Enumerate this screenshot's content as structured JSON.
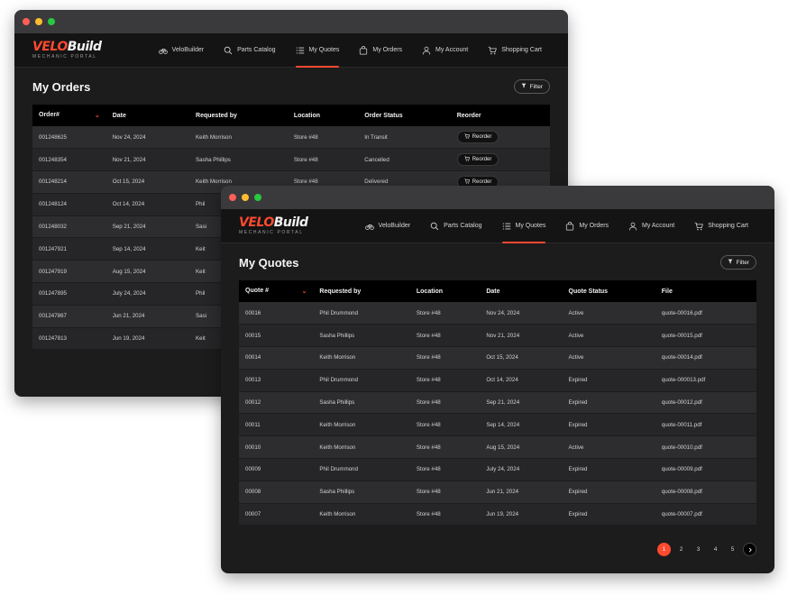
{
  "colors": {
    "accent": "#ff4a2f",
    "window_bg": "#1c1c1d",
    "navbar_bg": "#141415",
    "table_header_bg": "#000000"
  },
  "brand": {
    "logo_velo": "VELO",
    "logo_build": "Build",
    "subtitle": "Mechanic Portal"
  },
  "nav": {
    "items": [
      {
        "label": "VeloBuilder",
        "icon": "bicycle-icon"
      },
      {
        "label": "Parts Catalog",
        "icon": "search-icon"
      },
      {
        "label": "My Quotes",
        "icon": "list-icon"
      },
      {
        "label": "My Orders",
        "icon": "bag-icon"
      },
      {
        "label": "My Account",
        "icon": "user-icon"
      },
      {
        "label": "Shopping Cart",
        "icon": "cart-icon"
      }
    ]
  },
  "orders_window": {
    "active_nav": "My Quotes",
    "title": "My Orders",
    "filter_label": "Filter",
    "columns": [
      "Order#",
      "Date",
      "Requested by",
      "Location",
      "Order Status",
      "Reorder"
    ],
    "reorder_label": "Reorder",
    "rows": [
      {
        "order": "001248625",
        "date": "Nov 24, 2024",
        "requested_by": "Keith Morrison",
        "location": "Store #48",
        "status": "In Transit"
      },
      {
        "order": "001248354",
        "date": "Nov 21, 2024",
        "requested_by": "Sasha Phillips",
        "location": "Store #48",
        "status": "Cancelled"
      },
      {
        "order": "001248214",
        "date": "Oct 15, 2024",
        "requested_by": "Keith Morrison",
        "location": "Store #48",
        "status": "Delivered"
      },
      {
        "order": "001248124",
        "date": "Oct 14, 2024",
        "requested_by": "Phil",
        "location": "",
        "status": ""
      },
      {
        "order": "001248032",
        "date": "Sep 21, 2024",
        "requested_by": "Sasi",
        "location": "",
        "status": ""
      },
      {
        "order": "001247921",
        "date": "Sep 14, 2024",
        "requested_by": "Keit",
        "location": "",
        "status": ""
      },
      {
        "order": "001247919",
        "date": "Aug 15, 2024",
        "requested_by": "Keit",
        "location": "",
        "status": ""
      },
      {
        "order": "001247895",
        "date": "July 24, 2024",
        "requested_by": "Phil",
        "location": "",
        "status": ""
      },
      {
        "order": "001247867",
        "date": "Jun 21, 2024",
        "requested_by": "Sasi",
        "location": "",
        "status": ""
      },
      {
        "order": "001247813",
        "date": "Jun 19, 2024",
        "requested_by": "Keit",
        "location": "",
        "status": ""
      }
    ]
  },
  "quotes_window": {
    "active_nav": "My Quotes",
    "title": "My Quotes",
    "filter_label": "Filter",
    "columns": [
      "Quote #",
      "Requested by",
      "Location",
      "Date",
      "Quote Status",
      "File"
    ],
    "rows": [
      {
        "quote": "00016",
        "requested_by": "Phil Drummond",
        "location": "Store #48",
        "date": "Nov 24, 2024",
        "status": "Active",
        "file": "quote-00016.pdf"
      },
      {
        "quote": "00015",
        "requested_by": "Sasha Phillips",
        "location": "Store #48",
        "date": "Nov 21, 2024",
        "status": "Active",
        "file": "quote-00015.pdf"
      },
      {
        "quote": "00014",
        "requested_by": "Keith Morrison",
        "location": "Store #48",
        "date": "Oct 15, 2024",
        "status": "Active",
        "file": "quote-00014.pdf"
      },
      {
        "quote": "00013",
        "requested_by": "Phil Drummond",
        "location": "Store #48",
        "date": "Oct 14, 2024",
        "status": "Expired",
        "file": "quote-000013.pdf"
      },
      {
        "quote": "00012",
        "requested_by": "Sasha Phillips",
        "location": "Store #48",
        "date": "Sep 21, 2024",
        "status": "Expired",
        "file": "quote-00012.pdf"
      },
      {
        "quote": "00011",
        "requested_by": "Keith Morrison",
        "location": "Store #48",
        "date": "Sep 14, 2024",
        "status": "Expired",
        "file": "quote-00011.pdf"
      },
      {
        "quote": "00010",
        "requested_by": "Keith Morrison",
        "location": "Store #48",
        "date": "Aug 15, 2024",
        "status": "Active",
        "file": "quote-00010.pdf"
      },
      {
        "quote": "00009",
        "requested_by": "Phil Drummond",
        "location": "Store #48",
        "date": "July 24, 2024",
        "status": "Expired",
        "file": "quote-00009.pdf"
      },
      {
        "quote": "00008",
        "requested_by": "Sasha Phillips",
        "location": "Store #48",
        "date": "Jun 21, 2024",
        "status": "Expired",
        "file": "quote-00008.pdf"
      },
      {
        "quote": "00007",
        "requested_by": "Keith Morrison",
        "location": "Store #48",
        "date": "Jun 19, 2024",
        "status": "Expired",
        "file": "quote-00007.pdf"
      }
    ],
    "pagination": {
      "pages": [
        "1",
        "2",
        "3",
        "4",
        "5"
      ],
      "current": "1",
      "next_icon": "chevron-right-icon"
    }
  }
}
